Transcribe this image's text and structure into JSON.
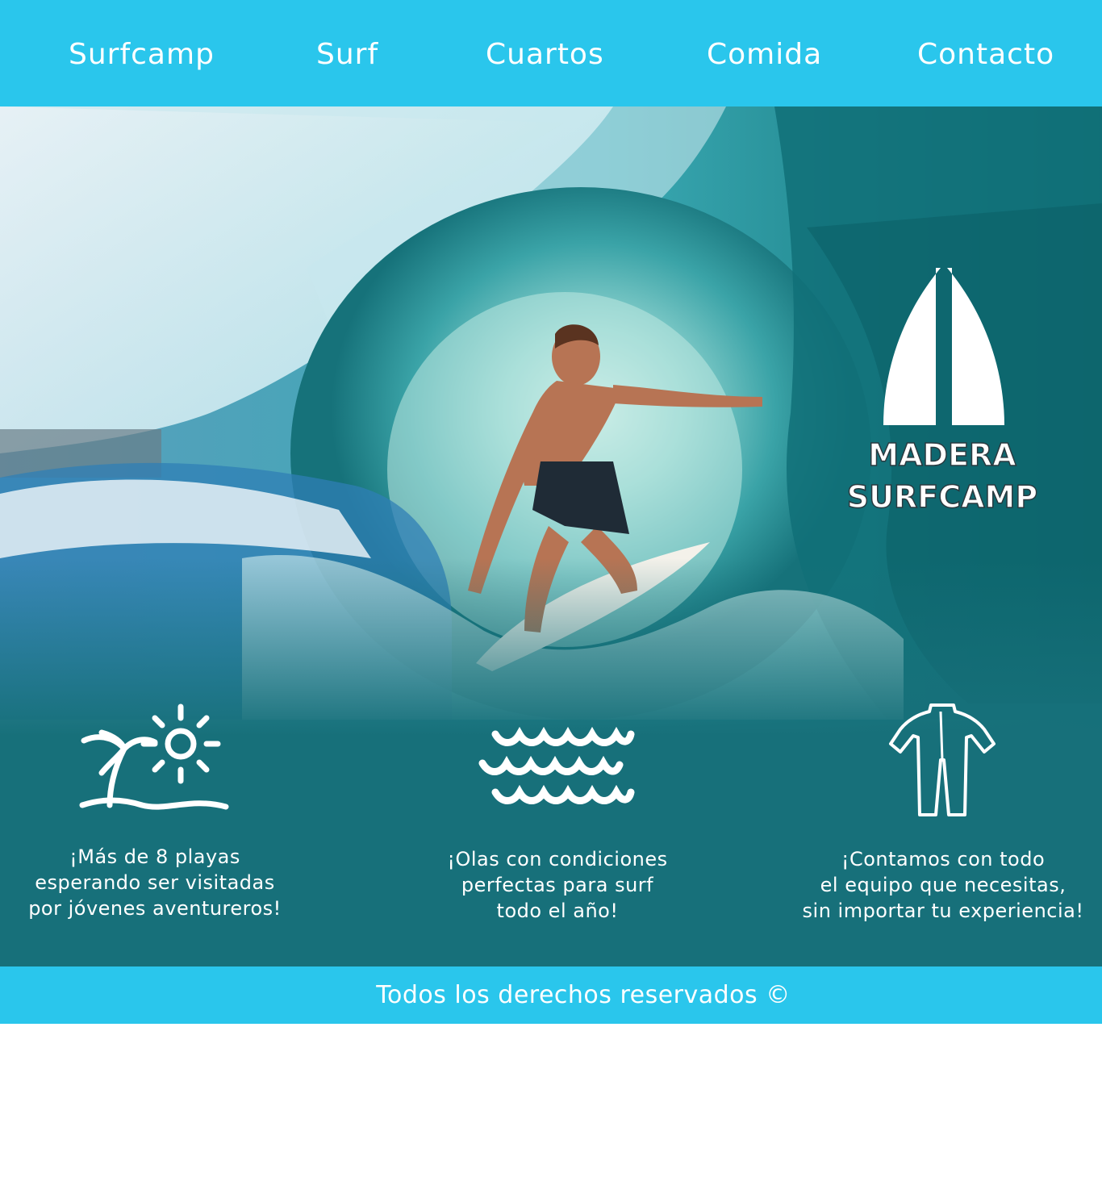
{
  "nav": {
    "items": [
      {
        "label": "Surfcamp"
      },
      {
        "label": "Surf"
      },
      {
        "label": "Cuartos"
      },
      {
        "label": "Comida"
      },
      {
        "label": "Contacto"
      }
    ]
  },
  "hero": {
    "logo": {
      "line1": "MADERA",
      "line2": "SURFCAMP",
      "icon": "surfboard-icon"
    }
  },
  "features": [
    {
      "icon": "palm-beach-sun-icon",
      "text": "¡Más de 8 playas\nesperando ser visitadas\npor jóvenes aventureros!"
    },
    {
      "icon": "waves-icon",
      "text": "¡Olas con condiciones\nperfectas para surf\ntodo el año!"
    },
    {
      "icon": "wetsuit-icon",
      "text": "¡Contamos con todo\nel equipo que necesitas,\nsin importar tu experiencia!"
    }
  ],
  "footer": {
    "text": "Todos los derechos reservados ©"
  },
  "colors": {
    "nav_bg": "#2ac6ec",
    "teal": "#17707a",
    "text": "#ffffff"
  }
}
